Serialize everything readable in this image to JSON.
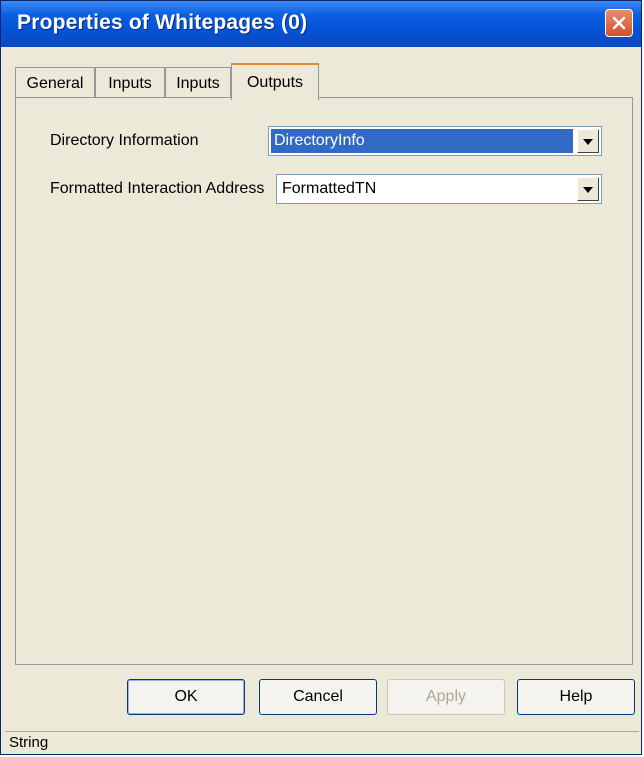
{
  "window": {
    "title": "Properties of Whitepages (0)"
  },
  "tabs": [
    {
      "label": "General"
    },
    {
      "label": "Inputs"
    },
    {
      "label": "Inputs"
    },
    {
      "label": "Outputs"
    }
  ],
  "active_tab": "Outputs",
  "form": {
    "directory_information": {
      "label": "Directory Information",
      "value": "DirectoryInfo"
    },
    "formatted_interaction_address": {
      "label": "Formatted Interaction Address",
      "value": "FormattedTN"
    }
  },
  "buttons": {
    "ok": "OK",
    "cancel": "Cancel",
    "apply": "Apply",
    "help": "Help"
  },
  "status": {
    "text": "String"
  },
  "colors": {
    "title_bar": "#0554d8",
    "selection": "#316ac5",
    "dialog_face": "#ece9d8",
    "close_button": "#d2502d"
  },
  "icons": {
    "close": "close-icon",
    "dropdown": "chevron-down-icon"
  }
}
